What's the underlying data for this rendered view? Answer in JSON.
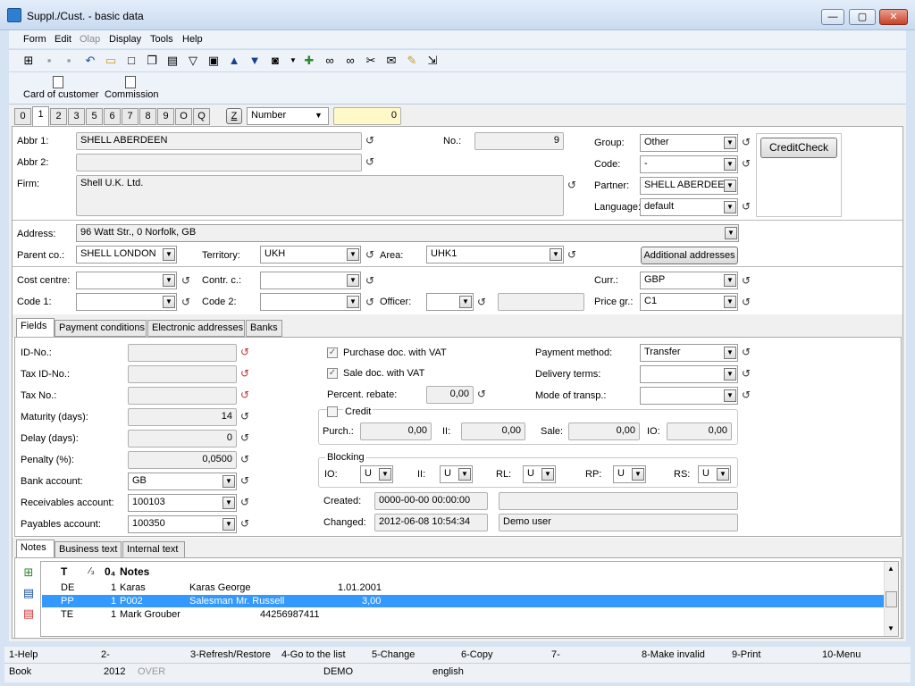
{
  "window": {
    "title": "Suppl./Cust. - basic data",
    "min": "—",
    "max": "▢",
    "close": "✕"
  },
  "menu": {
    "form": "Form",
    "edit": "Edit",
    "olap": "Olap",
    "display": "Display",
    "tools": "Tools",
    "help": "Help"
  },
  "toolbar2": {
    "card": "Card of customer",
    "commission": "Commission"
  },
  "num_tabs": [
    "0",
    "1",
    "2",
    "3",
    "5",
    "6",
    "7",
    "8",
    "9",
    "O",
    "Q"
  ],
  "sort": {
    "z": "Z",
    "field": "Number",
    "value": "0"
  },
  "header": {
    "abbr1_label": "Abbr 1:",
    "abbr1": "SHELL ABERDEEN",
    "abbr2_label": "Abbr 2:",
    "abbr2": "",
    "firm_label": "Firm:",
    "firm": "Shell U.K. Ltd.",
    "no_label": "No.:",
    "no": "9",
    "group_label": "Group:",
    "group": "Other",
    "code_label": "Code:",
    "code": "-",
    "partner_label": "Partner:",
    "partner": "SHELL ABERDEEN",
    "language_label": "Language:",
    "language": "default",
    "creditcheck": "CreditCheck"
  },
  "address": {
    "label": "Address:",
    "value": "96  Watt Str., 0  Norfolk, GB",
    "parent_label": "Parent co.:",
    "parent": "SHELL LONDON",
    "territory_label": "Territory:",
    "territory": "UKH",
    "area_label": "Area:",
    "area": "UHK1",
    "additional": "Additional addresses"
  },
  "costs": {
    "cost_centre_label": "Cost centre:",
    "contr_label": "Contr. c.:",
    "code1_label": "Code 1:",
    "code2_label": "Code 2:",
    "officer_label": "Officer:",
    "curr_label": "Curr.:",
    "curr": "GBP",
    "price_label": "Price gr.:",
    "price": "C1"
  },
  "subtabs": [
    "Fields",
    "Payment conditions",
    "Electronic addresses",
    "Banks"
  ],
  "fields": {
    "id_label": "ID-No.:",
    "tax_id_label": "Tax ID-No.:",
    "tax_no_label": "Tax No.:",
    "maturity_label": "Maturity (days):",
    "maturity": "14",
    "delay_label": "Delay  (days):",
    "delay": "0",
    "penalty_label": "Penalty (%):",
    "penalty": "0,0500",
    "bank_label": "Bank account:",
    "bank": "GB",
    "recv_label": "Receivables account:",
    "recv": "100103",
    "pay_label": "Payables account:",
    "pay": "100350",
    "purchase_vat": "Purchase doc. with VAT",
    "sale_vat": "Sale doc. with VAT",
    "rebate_label": "Percent. rebate:",
    "rebate": "0,00",
    "credit_label": "Credit",
    "purch_label": "Purch.:",
    "purch": "0,00",
    "ii_label": "II:",
    "ii": "0,00",
    "sale_label": "Sale:",
    "sale": "0,00",
    "io_label": "IO:",
    "io": "0,00",
    "blocking_label": "Blocking",
    "b_io": "IO:",
    "b_ii": "II:",
    "b_rl": "RL:",
    "b_rp": "RP:",
    "b_rs": "RS:",
    "u": "U",
    "created_label": "Created:",
    "created": "0000-00-00 00:00:00",
    "changed_label": "Changed:",
    "changed": "2012-06-08 10:54:34",
    "changed_by": "Demo user",
    "paymethod_label": "Payment method:",
    "paymethod": "Transfer",
    "delivery_label": "Delivery terms:",
    "transport_label": "Mode of transp.:"
  },
  "notes_tabs": [
    "Notes",
    "Business text",
    "Internal text"
  ],
  "notes_grid": {
    "headers": {
      "t": "T",
      "c2": "⁄₃",
      "c3": "0₄",
      "notes": "Notes"
    },
    "rows": [
      {
        "t": "DE",
        "n": "1",
        "a": "Karas",
        "b": "Karas George",
        "c": "1.01.2001"
      },
      {
        "t": "PP",
        "n": "1",
        "a": "P002",
        "b": "Salesman Mr. Russell",
        "c": "3,00"
      },
      {
        "t": "TE",
        "n": "1",
        "a": "Mark Grouber",
        "b": "",
        "c": "44256987411"
      }
    ]
  },
  "fkeys": [
    "1-Help",
    "2-",
    "3-Refresh/Restore",
    "4-Go to the list",
    "5-Change",
    "6-Copy",
    "7-",
    "8-Make invalid",
    "9-Print",
    "10-Menu"
  ],
  "status": {
    "book": "Book",
    "year": "2012",
    "over": "OVER",
    "demo": "DEMO",
    "lang": "english"
  }
}
